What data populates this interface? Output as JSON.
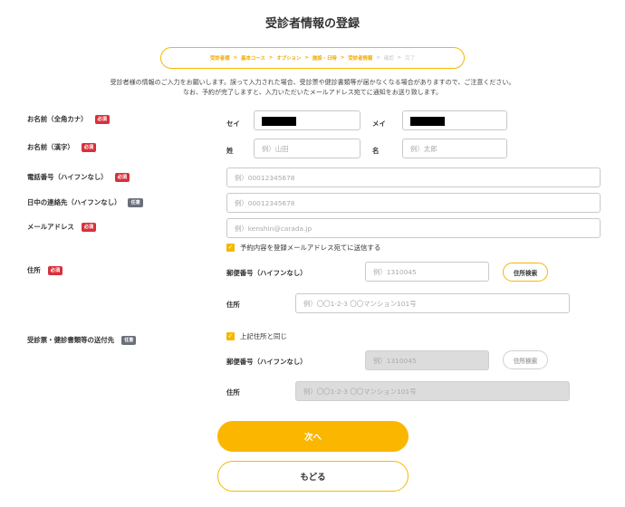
{
  "page": {
    "title": "受診者情報の登録"
  },
  "steps": [
    {
      "label": "受診者様",
      "active": true
    },
    {
      "label": "基本コース",
      "active": true
    },
    {
      "label": "オプション",
      "active": true
    },
    {
      "label": "施設・日時",
      "active": true
    },
    {
      "label": "受診者情報",
      "active": true
    },
    {
      "label": "確認",
      "active": false
    },
    {
      "label": "完了",
      "active": false
    }
  ],
  "step_separator": ">",
  "notice": {
    "line1": "受診者様の情報のご入力をお願いします。誤って入力された場合、受診票や健診書類等が届かなくなる場合がありますので、ご注意ください。",
    "line2": "なお、予約が完了しますと、入力いただいたメールアドレス宛てに通知をお送り致します。"
  },
  "badges": {
    "required": "必須",
    "optional": "任意"
  },
  "form": {
    "name_kana": {
      "label": "お名前（全角カナ）",
      "sei_label": "セイ",
      "mei_label": "メイ"
    },
    "name_kanji": {
      "label": "お名前（漢字）",
      "sei_label": "姓",
      "mei_label": "名",
      "sei_placeholder": "例）山田",
      "mei_placeholder": "例）太郎"
    },
    "phone": {
      "label": "電話番号（ハイフンなし）",
      "placeholder": "例）00012345678"
    },
    "day_phone": {
      "label": "日中の連絡先（ハイフンなし）",
      "placeholder": "例）00012345678"
    },
    "email": {
      "label": "メールアドレス",
      "placeholder": "例）kenshin@carada.jp",
      "checkbox_label": "予約内容を登録メールアドレス宛てに送信する"
    },
    "address": {
      "label": "住所",
      "zip_label": "郵便番号（ハイフンなし）",
      "zip_placeholder": "例）1310045",
      "search_button": "住所検索",
      "addr_label": "住所",
      "addr_placeholder": "例）〇〇1-2-3 〇〇マンション101号"
    },
    "delivery": {
      "label": "受診票・健診書類等の送付先",
      "checkbox_label": "上記住所と同じ",
      "zip_label": "郵便番号（ハイフンなし）",
      "zip_placeholder": "例）1310045",
      "search_button": "住所検索",
      "addr_label": "住所",
      "addr_placeholder": "例）〇〇1-2-3 〇〇マンション101号"
    }
  },
  "buttons": {
    "next": "次へ",
    "back": "もどる"
  },
  "colors": {
    "accent": "#f5b800",
    "required_badge": "#d8303c",
    "optional_badge": "#6b6f7a"
  }
}
